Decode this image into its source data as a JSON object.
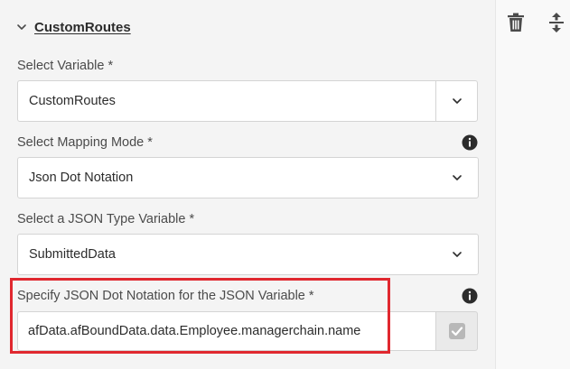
{
  "section": {
    "title": "CustomRoutes"
  },
  "select_variable": {
    "label": "Select Variable *",
    "value": "CustomRoutes"
  },
  "mapping_mode": {
    "label": "Select Mapping Mode *",
    "value": "Json Dot Notation"
  },
  "json_type_variable": {
    "label": "Select a JSON Type Variable *",
    "value": "SubmittedData"
  },
  "dot_notation": {
    "label": "Specify JSON Dot Notation for the JSON Variable *",
    "value": "afData.afBoundData.data.Employee.managerchain.name"
  },
  "icons": {
    "collapse": "chevron-down-icon",
    "info": "info-icon",
    "delete": "trash-icon",
    "reorder": "move-vertical-icon",
    "confirm": "checkmark-icon"
  },
  "colors": {
    "highlight": "#e0282f",
    "icon": "#4b4b4b"
  }
}
